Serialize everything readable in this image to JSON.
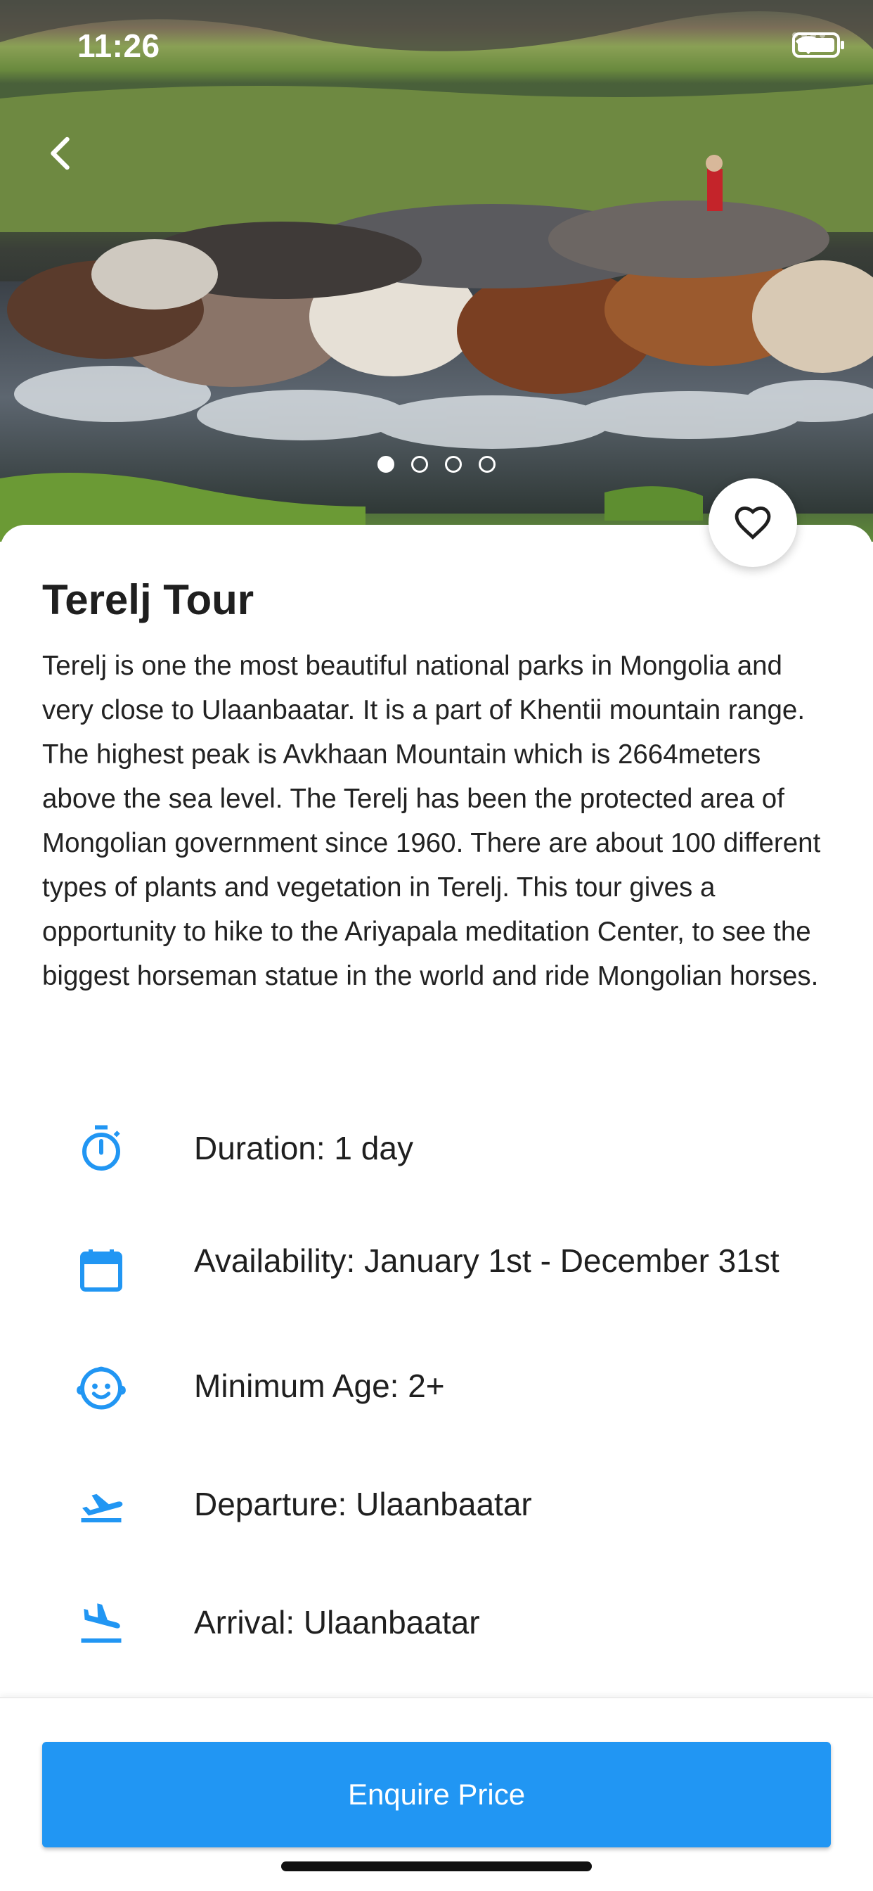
{
  "status_bar": {
    "time": "11:26"
  },
  "hero": {
    "image_icon": "photo-horses-river",
    "page_count": 4,
    "active_page": 1
  },
  "tour": {
    "title": "Terelj Tour",
    "description": "Terelj is one the most beautiful national parks in Mongolia and very close to Ulaanbaatar. It is a part of Khentii mountain range. The highest peak is Avkhaan Mountain which is 2664meters above the sea level. The Terelj has been the protected area of Mongolian government since 1960. There are about 100 different types of plants and vegetation in Terelj.  This tour gives a opportunity to hike to the Ariyapala meditation Center, to see the biggest horseman statue in the world and ride Mongolian horses."
  },
  "details": [
    {
      "icon": "timer-icon",
      "text": "Duration: 1 day"
    },
    {
      "icon": "calendar-icon",
      "text": "Availability: January 1st - December 31st"
    },
    {
      "icon": "child-face-icon",
      "text": "Minimum Age: 2+"
    },
    {
      "icon": "flight-takeoff-icon",
      "text": "Departure: Ulaanbaatar"
    },
    {
      "icon": "flight-land-icon",
      "text": "Arrival: Ulaanbaatar"
    }
  ],
  "actions": {
    "enquire_label": "Enquire Price"
  },
  "colors": {
    "accent": "#2196f3",
    "icon": "#2196f3",
    "text": "#1f1f1f"
  }
}
